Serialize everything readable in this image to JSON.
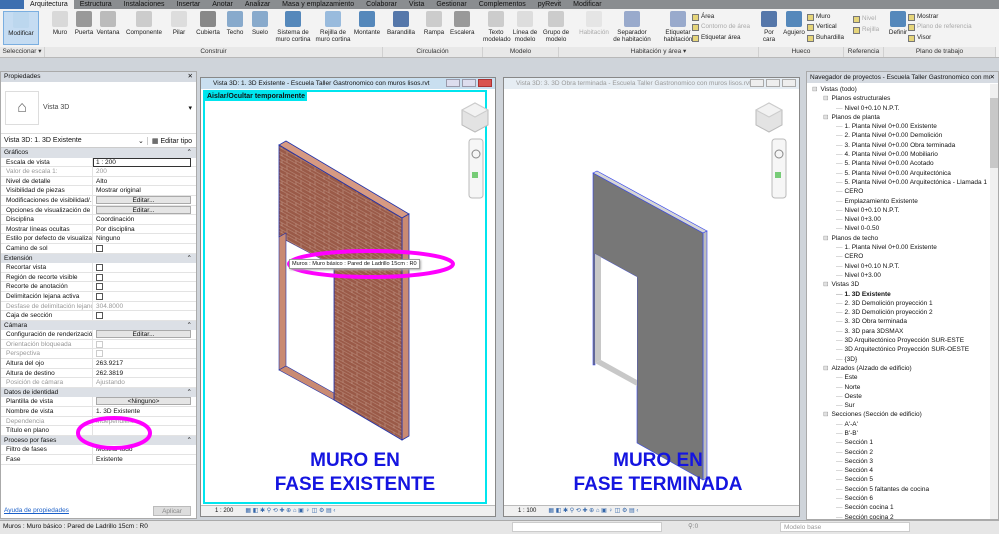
{
  "ribbon": {
    "tabs": [
      "Arquitectura",
      "Estructura",
      "Instalaciones",
      "Insertar",
      "Anotar",
      "Analizar",
      "Masa y emplazamiento",
      "Colaborar",
      "Vista",
      "Gestionar",
      "Complementos",
      "pyRevit",
      "Modificar"
    ],
    "active_tab": "Arquitectura",
    "buttons": [
      {
        "label": "Modificar",
        "icon": "cursor-icon"
      },
      {
        "label": "Muro",
        "icon": "wall-icon"
      },
      {
        "label": "Puerta",
        "icon": "door-icon"
      },
      {
        "label": "Ventana",
        "icon": "window-icon"
      },
      {
        "label": "Componente",
        "icon": "component-icon"
      },
      {
        "label": "Pilar",
        "icon": "column-icon"
      },
      {
        "label": "Cubierta",
        "icon": "roof-icon"
      },
      {
        "label": "Techo",
        "icon": "ceiling-icon"
      },
      {
        "label": "Suelo",
        "icon": "floor-icon"
      },
      {
        "label": "Sistema de muro cortina",
        "icon": "curtain-system-icon"
      },
      {
        "label": "Rejilla de muro cortina",
        "icon": "curtain-grid-icon"
      },
      {
        "label": "Montante",
        "icon": "mullion-icon"
      },
      {
        "label": "Barandilla",
        "icon": "railing-icon"
      },
      {
        "label": "Rampa",
        "icon": "ramp-icon"
      },
      {
        "label": "Escalera",
        "icon": "stair-icon"
      },
      {
        "label": "Texto modelado",
        "icon": "model-text-icon"
      },
      {
        "label": "Línea de modelo",
        "icon": "model-line-icon"
      },
      {
        "label": "Grupo de modelo",
        "icon": "model-group-icon"
      },
      {
        "label": "Habitación",
        "icon": "room-icon",
        "disabled": true
      },
      {
        "label": "Separador de habitación",
        "icon": "room-separator-icon"
      },
      {
        "label": "Etiquetar habitación",
        "icon": "tag-room-icon"
      },
      {
        "label": "Por cara",
        "icon": "by-face-icon"
      },
      {
        "label": "Agujero",
        "icon": "shaft-icon"
      },
      {
        "label": "Definir",
        "icon": "set-workplane-icon"
      }
    ],
    "small_buttons": [
      {
        "label": "Área",
        "disabled": false
      },
      {
        "label": "Contorno de área",
        "disabled": true
      },
      {
        "label": "Etiquetar área",
        "disabled": false
      },
      {
        "label": "Muro",
        "disabled": false
      },
      {
        "label": "Vertical",
        "disabled": false
      },
      {
        "label": "Buhardilla",
        "disabled": false
      },
      {
        "label": "Nivel",
        "disabled": true
      },
      {
        "label": "Rejilla",
        "disabled": true
      },
      {
        "label": "Mostrar",
        "disabled": false
      },
      {
        "label": "Plano de referencia",
        "disabled": true
      },
      {
        "label": "Visor",
        "disabled": false
      }
    ],
    "panels": [
      "Seleccionar ▾",
      "Construir",
      "Circulación",
      "Modelo",
      "Habitación y área ▾",
      "Hueco",
      "Referencia",
      "Plano de trabajo"
    ]
  },
  "properties": {
    "title": "Propiedades",
    "type_name": "Vista 3D",
    "instance_selector": "Vista 3D: 1. 3D Existente",
    "edit_type": "Editar tipo",
    "sections": [
      {
        "name": "Gráficos",
        "rows": [
          {
            "k": "Escala de vista",
            "v": "1 : 200",
            "input": true
          },
          {
            "k": "Valor de escala    1:",
            "v": "200",
            "gray": true
          },
          {
            "k": "Nivel de detalle",
            "v": "Alto"
          },
          {
            "k": "Visibilidad de piezas",
            "v": "Mostrar original"
          },
          {
            "k": "Modificaciones de visibilidad/...",
            "v": "Editar...",
            "button": true
          },
          {
            "k": "Opciones de visualización de ...",
            "v": "Editar...",
            "button": true
          },
          {
            "k": "Disciplina",
            "v": "Coordinación"
          },
          {
            "k": "Mostrar líneas ocultas",
            "v": "Por disciplina"
          },
          {
            "k": "Estilo por defecto de visualiza...",
            "v": "Ninguno"
          },
          {
            "k": "Camino de sol",
            "v": "",
            "check": true
          }
        ]
      },
      {
        "name": "Extensión",
        "rows": [
          {
            "k": "Recortar vista",
            "v": "",
            "check": true
          },
          {
            "k": "Región de recorte visible",
            "v": "",
            "check": true
          },
          {
            "k": "Recorte de anotación",
            "v": "",
            "check": true
          },
          {
            "k": "Delimitación lejana activa",
            "v": "",
            "check": true
          },
          {
            "k": "Desfase de delimitación lejano",
            "v": "304.8000",
            "gray": true
          },
          {
            "k": "Caja de sección",
            "v": "",
            "check": true
          }
        ]
      },
      {
        "name": "Cámara",
        "rows": [
          {
            "k": "Configuración de renderización",
            "v": "Editar...",
            "button": true
          },
          {
            "k": "Orientación bloqueada",
            "v": "",
            "check": true,
            "gray": true
          },
          {
            "k": "Perspectiva",
            "v": "",
            "check": true,
            "gray": true
          },
          {
            "k": "Altura del ojo",
            "v": "263.9217"
          },
          {
            "k": "Altura de destino",
            "v": "262.3819"
          },
          {
            "k": "Posición de cámara",
            "v": "Ajustando",
            "gray": true
          }
        ]
      },
      {
        "name": "Datos de identidad",
        "rows": [
          {
            "k": "Plantilla de vista",
            "v": "<Ninguno>",
            "button": true
          },
          {
            "k": "Nombre de vista",
            "v": "1. 3D Existente"
          },
          {
            "k": "Dependencia",
            "v": "Independiente",
            "gray": true
          },
          {
            "k": "Título en plano",
            "v": ""
          }
        ]
      },
      {
        "name": "Proceso por fases",
        "rows": [
          {
            "k": "Filtro de fases",
            "v": "Mostrar todo"
          },
          {
            "k": "Fase",
            "v": "Existente"
          }
        ]
      }
    ],
    "help_link": "Ayuda de propiedades",
    "apply": "Aplicar"
  },
  "views": [
    {
      "title": "Vista 3D: 1. 3D Existente - Escuela Taller Gastronomico con muros lisos.rvt",
      "active": true,
      "banner": "Aislar/Ocultar temporalmente",
      "scale": "1 : 200",
      "tooltip": "Muros : Muro básico : Pared de Ladrillo 15cm : R0",
      "caption1": "MURO EN",
      "caption2": "FASE EXISTENTE",
      "wall_color": "#9a5a48"
    },
    {
      "title": "Vista 3D: 3. 3D Obra terminada - Escuela Taller Gastronomico con muros lisos.rvt",
      "active": false,
      "scale": "1 : 100",
      "caption1": "MURO EN",
      "caption2": "FASE TERMINADA",
      "wall_color": "#777777"
    }
  ],
  "browser": {
    "title": "Navegador de proyectos - Escuela Taller Gastronomico con muros...",
    "items": [
      {
        "t": "Vistas (todo)",
        "l": 0
      },
      {
        "t": "Planos estructurales",
        "l": 1
      },
      {
        "t": "Nivel 0+0.10 N.P.T.",
        "l": 2
      },
      {
        "t": "Planos de planta",
        "l": 1
      },
      {
        "t": "1. Planta Nivel 0+0.00 Existente",
        "l": 2
      },
      {
        "t": "2. Planta Nivel 0+0.00 Demolición",
        "l": 2
      },
      {
        "t": "3. Planta Nivel 0+0.00 Obra terminada",
        "l": 2
      },
      {
        "t": "4. Planta Nivel 0+0.00 Mobiliario",
        "l": 2
      },
      {
        "t": "5. Planta Nivel 0+0.00 Acotado",
        "l": 2
      },
      {
        "t": "5. Planta Nivel 0+0.00 Arquitectónica",
        "l": 2
      },
      {
        "t": "5. Planta Nivel 0+0.00 Arquitectónica - Llamada 1",
        "l": 2
      },
      {
        "t": "CERO",
        "l": 2
      },
      {
        "t": "Emplazamiento Existente",
        "l": 2
      },
      {
        "t": "Nivel 0+0.10 N.P.T.",
        "l": 2
      },
      {
        "t": "Nivel 0+3.00",
        "l": 2
      },
      {
        "t": "Nivel 0-0.50",
        "l": 2
      },
      {
        "t": "Planos de techo",
        "l": 1
      },
      {
        "t": "1. Planta Nivel 0+0.00 Existente",
        "l": 2
      },
      {
        "t": "CERO",
        "l": 2
      },
      {
        "t": "Nivel 0+0.10 N.P.T.",
        "l": 2
      },
      {
        "t": "Nivel 0+3.00",
        "l": 2
      },
      {
        "t": "Vistas 3D",
        "l": 1
      },
      {
        "t": "1. 3D Existente",
        "l": 2,
        "bold": true
      },
      {
        "t": "2. 3D Demolición proyección 1",
        "l": 2
      },
      {
        "t": "2. 3D Demolición proyección 2",
        "l": 2
      },
      {
        "t": "3. 3D Obra terminada",
        "l": 2
      },
      {
        "t": "3. 3D para 3DSMAX",
        "l": 2
      },
      {
        "t": "3D Arquitectónico Proyección SUR-ESTE",
        "l": 2
      },
      {
        "t": "3D Arquitectónico Proyección SUR-OESTE",
        "l": 2
      },
      {
        "t": "{3D}",
        "l": 2
      },
      {
        "t": "Alzados (Alzado de edificio)",
        "l": 1
      },
      {
        "t": "Este",
        "l": 2
      },
      {
        "t": "Norte",
        "l": 2
      },
      {
        "t": "Oeste",
        "l": 2
      },
      {
        "t": "Sur",
        "l": 2
      },
      {
        "t": "Secciones (Sección de edificio)",
        "l": 1
      },
      {
        "t": "A'-A'",
        "l": 2
      },
      {
        "t": "B'-B'",
        "l": 2
      },
      {
        "t": "Sección 1",
        "l": 2
      },
      {
        "t": "Sección 2",
        "l": 2
      },
      {
        "t": "Sección 3",
        "l": 2
      },
      {
        "t": "Sección 4",
        "l": 2
      },
      {
        "t": "Sección 5",
        "l": 2
      },
      {
        "t": "Sección 5 faltantes de cocina",
        "l": 2
      },
      {
        "t": "Sección 6",
        "l": 2
      },
      {
        "t": "Sección cocina 1",
        "l": 2
      },
      {
        "t": "Sección cocina 2",
        "l": 2
      }
    ]
  },
  "status": {
    "text": "Muros : Muro básico : Pared de Ladrillo 15cm : R0",
    "filter_count": ":0",
    "model": "Modelo base"
  },
  "colors": {
    "highlight": "#ff00ff",
    "active_view_border": "#00e5ee",
    "caption": "#1515e0",
    "wall_edge": "#2233aa"
  }
}
